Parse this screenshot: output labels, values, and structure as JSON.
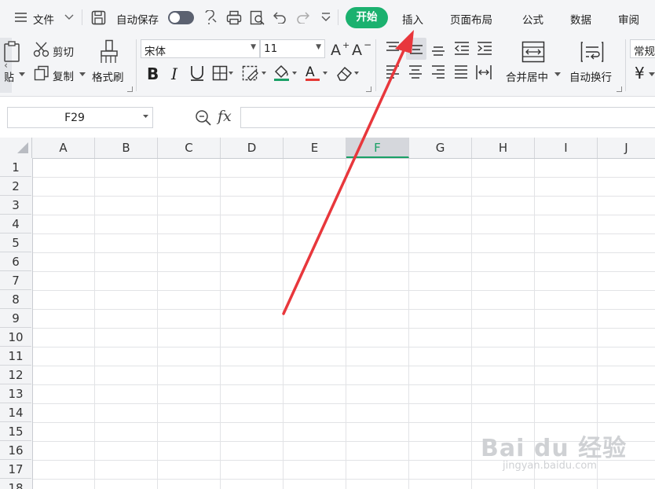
{
  "menu": {
    "file_label": "文件",
    "autosave_label": "自动保存",
    "tabs": [
      {
        "label": "开始",
        "active": true
      },
      {
        "label": "插入"
      },
      {
        "label": "页面布局"
      },
      {
        "label": "公式"
      },
      {
        "label": "数据"
      },
      {
        "label": "审阅"
      }
    ]
  },
  "ribbon": {
    "paste_label": "粘贴",
    "cut_label": "剪切",
    "copy_label": "复制",
    "format_painter_label": "格式刷",
    "font_name": "宋体",
    "font_size": "11",
    "merge_center_label": "合并居中",
    "wrap_text_label": "自动换行",
    "number_format": "常规",
    "currency_symbol": "¥"
  },
  "formula_bar": {
    "cell_ref": "F29",
    "fx_label": "fx",
    "formula": ""
  },
  "grid": {
    "columns": [
      "A",
      "B",
      "C",
      "D",
      "E",
      "F",
      "G",
      "H",
      "I",
      "J"
    ],
    "selected_column": "F",
    "rows": [
      "1",
      "2",
      "3",
      "4",
      "5",
      "6",
      "7",
      "8",
      "9",
      "10",
      "11",
      "12",
      "13",
      "14",
      "15",
      "16",
      "17",
      "18"
    ]
  },
  "watermark": {
    "brand": "Bai du 经验",
    "url": "jingyan.baidu.com"
  },
  "colors": {
    "accent": "#1bb16f",
    "annotation_arrow": "#e8373c"
  }
}
